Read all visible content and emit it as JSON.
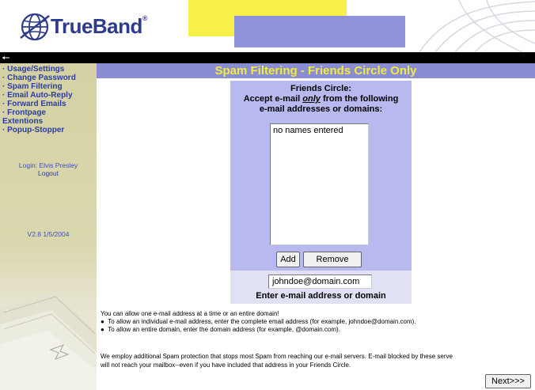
{
  "header": {
    "brand": "TrueBand",
    "brand_mark": "®"
  },
  "nav": {
    "back_icon": "back-arrow-icon",
    "items": [
      {
        "label": "· Usage/Settings"
      },
      {
        "label": "· Change Password"
      },
      {
        "label": "· Spam Filtering"
      },
      {
        "label": "· Email Auto-Reply"
      },
      {
        "label": "· Forward Emails"
      },
      {
        "label": "· Frontpage"
      },
      {
        "label": "Extentions"
      },
      {
        "label": "· Popup-Stopper"
      }
    ]
  },
  "account": {
    "login_text": "Login: Elvis Presley",
    "logout_label": "Logout"
  },
  "version": "V2.8 1/5/2004",
  "page": {
    "title": "Spam Filtering - Friends Circle Only"
  },
  "friends": {
    "line1": "Friends Circle:",
    "line2_pre": "Accept e-mail ",
    "line2_em": "only",
    "line2_post": " from the following",
    "line3": "e-mail addresses or domains:",
    "list_items": [
      "no names entered"
    ],
    "add_label": "Add",
    "remove_label": "Remove"
  },
  "email": {
    "value": "johndoe@domain.com",
    "caption": "Enter e-mail address or domain"
  },
  "help": {
    "intro": "You can allow one e-mail address at a time or an entire domain!",
    "bullet1": "To allow an individual e-mail address, enter the complete email address (for example, johndoe@domain.com).",
    "bullet2": "To allow an entire domain, enter the domain address (for example, @domain.com).",
    "note_line1": "We employ additional Spam protection that stops most Spam from reaching our e-mail servers. E-mail blocked by these serve",
    "note_line2": "will not reach your mailbox--even if you have included that address in your Friends Circle."
  },
  "next_label": "Next>>>",
  "colors": {
    "nav_text": "#2c3c9e",
    "title_bar": "#8a8cd4",
    "title_text": "#f2ec3b",
    "panel": "#b8b9ee",
    "sidebar": "#d4d2a4"
  }
}
